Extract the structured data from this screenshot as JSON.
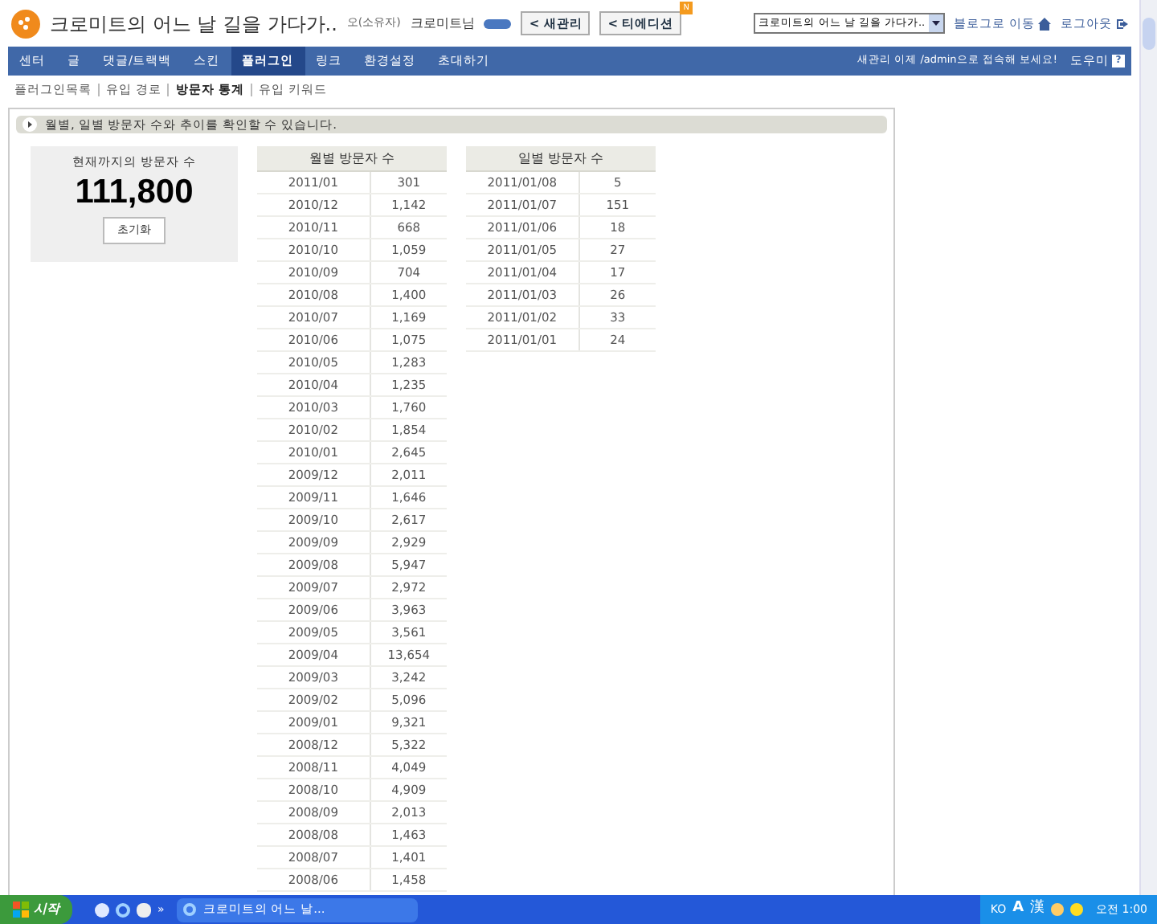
{
  "header": {
    "blog_title": "크로미트의 어느 날 길을 가다가..",
    "role": "오(소유자)",
    "user": "크로미트님",
    "buttons": [
      {
        "label": "< 새관리"
      },
      {
        "label": "< 티에디션",
        "badge": "N"
      }
    ],
    "blog_select": "크로미트의 어느 날 길을 가다가..",
    "links": [
      {
        "kind": "home",
        "label": "블로그로 이동"
      },
      {
        "kind": "logout",
        "label": "로그아웃"
      }
    ]
  },
  "nav": {
    "items": [
      {
        "label": "센터",
        "selected": false
      },
      {
        "label": "글",
        "selected": false
      },
      {
        "label": "댓글/트랙백",
        "selected": false
      },
      {
        "label": "스킨",
        "selected": false
      },
      {
        "label": "플러그인",
        "selected": true
      },
      {
        "label": "링크",
        "selected": false
      },
      {
        "label": "환경설정",
        "selected": false
      },
      {
        "label": "초대하기",
        "selected": false
      }
    ],
    "notice": "새관리 이제 /admin으로 접속해 보세요!",
    "help": "도우미",
    "help_icon": "?"
  },
  "subnav": [
    {
      "label": "플러그인목록",
      "selected": false
    },
    {
      "label": "유입 경로",
      "selected": false
    },
    {
      "label": "방문자 통계",
      "selected": true
    },
    {
      "label": "유입 키워드",
      "selected": false
    }
  ],
  "info": "월별, 일별 방문자 수와 추이를 확인할 수 있습니다.",
  "counter": {
    "label": "현재까지의 방문자 수",
    "value": "111,800",
    "button": "초기화"
  },
  "monthly": {
    "title": "월별 방문자 수",
    "rows": [
      [
        "2011/01",
        "301"
      ],
      [
        "2010/12",
        "1,142"
      ],
      [
        "2010/11",
        "668"
      ],
      [
        "2010/10",
        "1,059"
      ],
      [
        "2010/09",
        "704"
      ],
      [
        "2010/08",
        "1,400"
      ],
      [
        "2010/07",
        "1,169"
      ],
      [
        "2010/06",
        "1,075"
      ],
      [
        "2010/05",
        "1,283"
      ],
      [
        "2010/04",
        "1,235"
      ],
      [
        "2010/03",
        "1,760"
      ],
      [
        "2010/02",
        "1,854"
      ],
      [
        "2010/01",
        "2,645"
      ],
      [
        "2009/12",
        "2,011"
      ],
      [
        "2009/11",
        "1,646"
      ],
      [
        "2009/10",
        "2,617"
      ],
      [
        "2009/09",
        "2,929"
      ],
      [
        "2009/08",
        "5,947"
      ],
      [
        "2009/07",
        "2,972"
      ],
      [
        "2009/06",
        "3,963"
      ],
      [
        "2009/05",
        "3,561"
      ],
      [
        "2009/04",
        "13,654"
      ],
      [
        "2009/03",
        "3,242"
      ],
      [
        "2009/02",
        "5,096"
      ],
      [
        "2009/01",
        "9,321"
      ],
      [
        "2008/12",
        "5,322"
      ],
      [
        "2008/11",
        "4,049"
      ],
      [
        "2008/10",
        "4,909"
      ],
      [
        "2008/09",
        "2,013"
      ],
      [
        "2008/08",
        "1,463"
      ],
      [
        "2008/07",
        "1,401"
      ],
      [
        "2008/06",
        "1,458"
      ]
    ]
  },
  "daily": {
    "title": "일별 방문자 수",
    "rows": [
      [
        "2011/01/08",
        "5"
      ],
      [
        "2011/01/07",
        "151"
      ],
      [
        "2011/01/06",
        "18"
      ],
      [
        "2011/01/05",
        "27"
      ],
      [
        "2011/01/04",
        "17"
      ],
      [
        "2011/01/03",
        "26"
      ],
      [
        "2011/01/02",
        "33"
      ],
      [
        "2011/01/01",
        "24"
      ]
    ]
  },
  "taskbar": {
    "start": "시작",
    "more": "»",
    "window": "크로미트의 어느 날...",
    "lang": "KO",
    "ime": "A",
    "hanja": "漢",
    "clock": "오전 1:00"
  }
}
